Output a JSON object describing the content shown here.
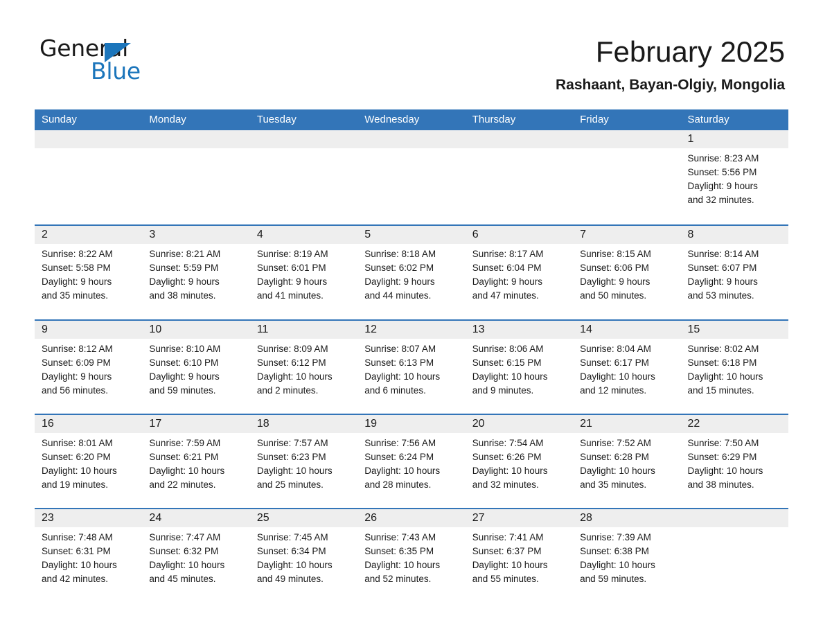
{
  "brand": {
    "name_part1": "General",
    "name_part2": "Blue",
    "logo_icon": "triangle-mark",
    "color_black": "#1a1a1a",
    "color_blue": "#1B75BB"
  },
  "header": {
    "title": "February 2025",
    "subtitle": "Rashaant, Bayan-Olgiy, Mongolia"
  },
  "theme": {
    "header_blue": "#3375B8",
    "daynum_gray": "#eeeeee",
    "text": "#1a1a1a"
  },
  "weekdays": [
    "Sunday",
    "Monday",
    "Tuesday",
    "Wednesday",
    "Thursday",
    "Friday",
    "Saturday"
  ],
  "labels": {
    "sunrise": "Sunrise:",
    "sunset": "Sunset:",
    "daylight": "Daylight:"
  },
  "weeks": [
    [
      {
        "day": "",
        "sunrise": "",
        "sunset": "",
        "daylight_line1": "",
        "daylight_line2": ""
      },
      {
        "day": "",
        "sunrise": "",
        "sunset": "",
        "daylight_line1": "",
        "daylight_line2": ""
      },
      {
        "day": "",
        "sunrise": "",
        "sunset": "",
        "daylight_line1": "",
        "daylight_line2": ""
      },
      {
        "day": "",
        "sunrise": "",
        "sunset": "",
        "daylight_line1": "",
        "daylight_line2": ""
      },
      {
        "day": "",
        "sunrise": "",
        "sunset": "",
        "daylight_line1": "",
        "daylight_line2": ""
      },
      {
        "day": "",
        "sunrise": "",
        "sunset": "",
        "daylight_line1": "",
        "daylight_line2": ""
      },
      {
        "day": "1",
        "sunrise": "Sunrise: 8:23 AM",
        "sunset": "Sunset: 5:56 PM",
        "daylight_line1": "Daylight: 9 hours",
        "daylight_line2": "and 32 minutes."
      }
    ],
    [
      {
        "day": "2",
        "sunrise": "Sunrise: 8:22 AM",
        "sunset": "Sunset: 5:58 PM",
        "daylight_line1": "Daylight: 9 hours",
        "daylight_line2": "and 35 minutes."
      },
      {
        "day": "3",
        "sunrise": "Sunrise: 8:21 AM",
        "sunset": "Sunset: 5:59 PM",
        "daylight_line1": "Daylight: 9 hours",
        "daylight_line2": "and 38 minutes."
      },
      {
        "day": "4",
        "sunrise": "Sunrise: 8:19 AM",
        "sunset": "Sunset: 6:01 PM",
        "daylight_line1": "Daylight: 9 hours",
        "daylight_line2": "and 41 minutes."
      },
      {
        "day": "5",
        "sunrise": "Sunrise: 8:18 AM",
        "sunset": "Sunset: 6:02 PM",
        "daylight_line1": "Daylight: 9 hours",
        "daylight_line2": "and 44 minutes."
      },
      {
        "day": "6",
        "sunrise": "Sunrise: 8:17 AM",
        "sunset": "Sunset: 6:04 PM",
        "daylight_line1": "Daylight: 9 hours",
        "daylight_line2": "and 47 minutes."
      },
      {
        "day": "7",
        "sunrise": "Sunrise: 8:15 AM",
        "sunset": "Sunset: 6:06 PM",
        "daylight_line1": "Daylight: 9 hours",
        "daylight_line2": "and 50 minutes."
      },
      {
        "day": "8",
        "sunrise": "Sunrise: 8:14 AM",
        "sunset": "Sunset: 6:07 PM",
        "daylight_line1": "Daylight: 9 hours",
        "daylight_line2": "and 53 minutes."
      }
    ],
    [
      {
        "day": "9",
        "sunrise": "Sunrise: 8:12 AM",
        "sunset": "Sunset: 6:09 PM",
        "daylight_line1": "Daylight: 9 hours",
        "daylight_line2": "and 56 minutes."
      },
      {
        "day": "10",
        "sunrise": "Sunrise: 8:10 AM",
        "sunset": "Sunset: 6:10 PM",
        "daylight_line1": "Daylight: 9 hours",
        "daylight_line2": "and 59 minutes."
      },
      {
        "day": "11",
        "sunrise": "Sunrise: 8:09 AM",
        "sunset": "Sunset: 6:12 PM",
        "daylight_line1": "Daylight: 10 hours",
        "daylight_line2": "and 2 minutes."
      },
      {
        "day": "12",
        "sunrise": "Sunrise: 8:07 AM",
        "sunset": "Sunset: 6:13 PM",
        "daylight_line1": "Daylight: 10 hours",
        "daylight_line2": "and 6 minutes."
      },
      {
        "day": "13",
        "sunrise": "Sunrise: 8:06 AM",
        "sunset": "Sunset: 6:15 PM",
        "daylight_line1": "Daylight: 10 hours",
        "daylight_line2": "and 9 minutes."
      },
      {
        "day": "14",
        "sunrise": "Sunrise: 8:04 AM",
        "sunset": "Sunset: 6:17 PM",
        "daylight_line1": "Daylight: 10 hours",
        "daylight_line2": "and 12 minutes."
      },
      {
        "day": "15",
        "sunrise": "Sunrise: 8:02 AM",
        "sunset": "Sunset: 6:18 PM",
        "daylight_line1": "Daylight: 10 hours",
        "daylight_line2": "and 15 minutes."
      }
    ],
    [
      {
        "day": "16",
        "sunrise": "Sunrise: 8:01 AM",
        "sunset": "Sunset: 6:20 PM",
        "daylight_line1": "Daylight: 10 hours",
        "daylight_line2": "and 19 minutes."
      },
      {
        "day": "17",
        "sunrise": "Sunrise: 7:59 AM",
        "sunset": "Sunset: 6:21 PM",
        "daylight_line1": "Daylight: 10 hours",
        "daylight_line2": "and 22 minutes."
      },
      {
        "day": "18",
        "sunrise": "Sunrise: 7:57 AM",
        "sunset": "Sunset: 6:23 PM",
        "daylight_line1": "Daylight: 10 hours",
        "daylight_line2": "and 25 minutes."
      },
      {
        "day": "19",
        "sunrise": "Sunrise: 7:56 AM",
        "sunset": "Sunset: 6:24 PM",
        "daylight_line1": "Daylight: 10 hours",
        "daylight_line2": "and 28 minutes."
      },
      {
        "day": "20",
        "sunrise": "Sunrise: 7:54 AM",
        "sunset": "Sunset: 6:26 PM",
        "daylight_line1": "Daylight: 10 hours",
        "daylight_line2": "and 32 minutes."
      },
      {
        "day": "21",
        "sunrise": "Sunrise: 7:52 AM",
        "sunset": "Sunset: 6:28 PM",
        "daylight_line1": "Daylight: 10 hours",
        "daylight_line2": "and 35 minutes."
      },
      {
        "day": "22",
        "sunrise": "Sunrise: 7:50 AM",
        "sunset": "Sunset: 6:29 PM",
        "daylight_line1": "Daylight: 10 hours",
        "daylight_line2": "and 38 minutes."
      }
    ],
    [
      {
        "day": "23",
        "sunrise": "Sunrise: 7:48 AM",
        "sunset": "Sunset: 6:31 PM",
        "daylight_line1": "Daylight: 10 hours",
        "daylight_line2": "and 42 minutes."
      },
      {
        "day": "24",
        "sunrise": "Sunrise: 7:47 AM",
        "sunset": "Sunset: 6:32 PM",
        "daylight_line1": "Daylight: 10 hours",
        "daylight_line2": "and 45 minutes."
      },
      {
        "day": "25",
        "sunrise": "Sunrise: 7:45 AM",
        "sunset": "Sunset: 6:34 PM",
        "daylight_line1": "Daylight: 10 hours",
        "daylight_line2": "and 49 minutes."
      },
      {
        "day": "26",
        "sunrise": "Sunrise: 7:43 AM",
        "sunset": "Sunset: 6:35 PM",
        "daylight_line1": "Daylight: 10 hours",
        "daylight_line2": "and 52 minutes."
      },
      {
        "day": "27",
        "sunrise": "Sunrise: 7:41 AM",
        "sunset": "Sunset: 6:37 PM",
        "daylight_line1": "Daylight: 10 hours",
        "daylight_line2": "and 55 minutes."
      },
      {
        "day": "28",
        "sunrise": "Sunrise: 7:39 AM",
        "sunset": "Sunset: 6:38 PM",
        "daylight_line1": "Daylight: 10 hours",
        "daylight_line2": "and 59 minutes."
      },
      {
        "day": "",
        "sunrise": "",
        "sunset": "",
        "daylight_line1": "",
        "daylight_line2": ""
      }
    ]
  ]
}
